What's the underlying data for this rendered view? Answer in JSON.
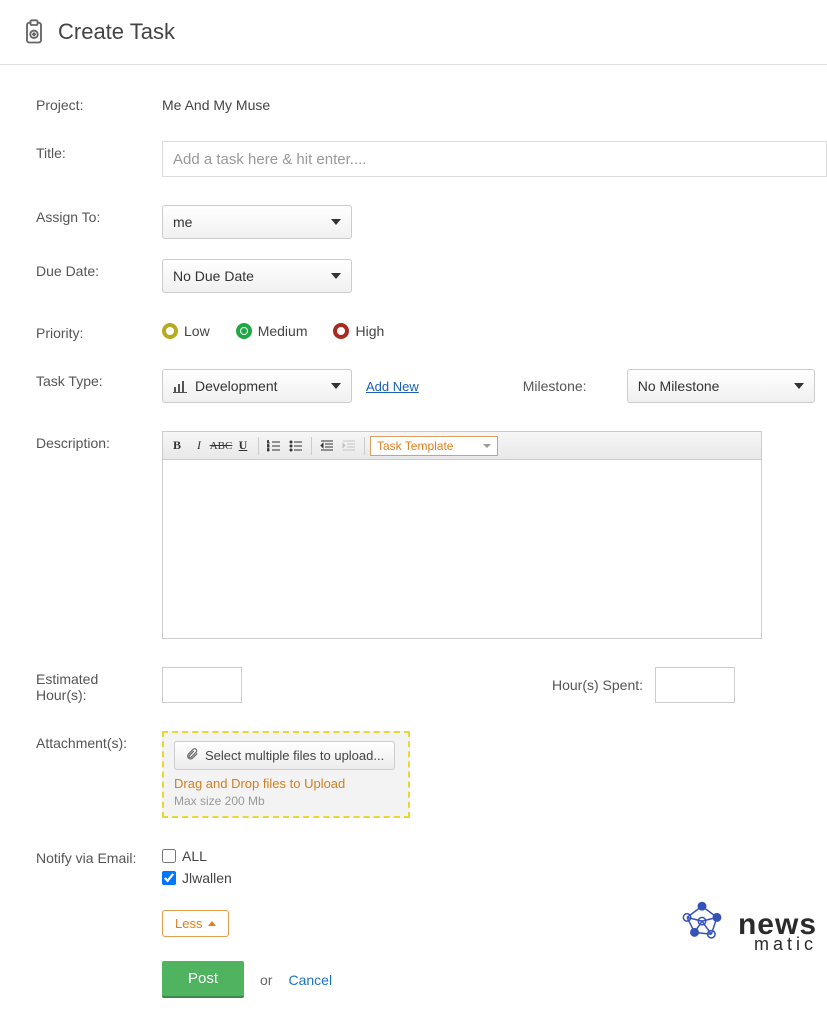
{
  "header": {
    "title": "Create Task"
  },
  "labels": {
    "project": "Project:",
    "title": "Title:",
    "assign_to": "Assign To:",
    "due_date": "Due Date:",
    "priority": "Priority:",
    "task_type": "Task Type:",
    "milestone": "Milestone:",
    "description": "Description:",
    "est_hours_line1": "Estimated",
    "est_hours_line2": "Hour(s):",
    "hours_spent": "Hour(s) Spent:",
    "attachments": "Attachment(s):",
    "notify": "Notify via Email:"
  },
  "project": {
    "name": "Me And My Muse"
  },
  "title_field": {
    "placeholder": "Add a task here & hit enter...."
  },
  "assign_to": {
    "value": "me"
  },
  "due_date": {
    "value": "No Due Date"
  },
  "priority": {
    "low": "Low",
    "medium": "Medium",
    "high": "High",
    "selected": "medium"
  },
  "task_type": {
    "value": "Development",
    "add_new": "Add New"
  },
  "milestone": {
    "value": "No Milestone"
  },
  "editor": {
    "template_label": "Task Template",
    "bold": "B",
    "italic": "I",
    "strike": "ABC",
    "underline": "U"
  },
  "attachments": {
    "button": "Select multiple files to upload...",
    "drag": "Drag and Drop files to Upload",
    "max": "Max size 200 Mb"
  },
  "notify": {
    "all": "ALL",
    "user1": "Jlwallen",
    "less": "Less"
  },
  "footer": {
    "post": "Post",
    "or": "or",
    "cancel": "Cancel"
  },
  "watermark": {
    "brand1": "news",
    "brand2": "matic"
  }
}
